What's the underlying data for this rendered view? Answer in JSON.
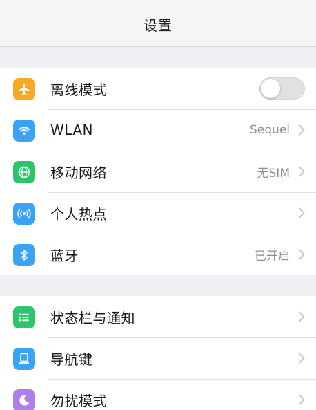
{
  "header": {
    "title": "设置"
  },
  "group1": {
    "airplane": {
      "label": "离线模式",
      "icon": "airplane-icon",
      "color": "#f9a825",
      "toggle_on": false
    },
    "wlan": {
      "label": "WLAN",
      "value": "Sequel",
      "icon": "wifi-icon",
      "color": "#3aa3f5"
    },
    "mobile": {
      "label": "移动网络",
      "value": "无SIM",
      "icon": "globe-icon",
      "color": "#2fc36c"
    },
    "hotspot": {
      "label": "个人热点",
      "icon": "hotspot-icon",
      "color": "#3aa3f5"
    },
    "bluetooth": {
      "label": "蓝牙",
      "value": "已开启",
      "icon": "bluetooth-icon",
      "color": "#3aa3f5"
    }
  },
  "group2": {
    "statusbar": {
      "label": "状态栏与通知",
      "icon": "list-icon",
      "color": "#2fc36c"
    },
    "navkeys": {
      "label": "导航键",
      "icon": "navigation-key-icon",
      "color": "#3aa3f5"
    },
    "dnd": {
      "label": "勿扰模式",
      "icon": "moon-icon",
      "color": "#b07ee8"
    }
  }
}
